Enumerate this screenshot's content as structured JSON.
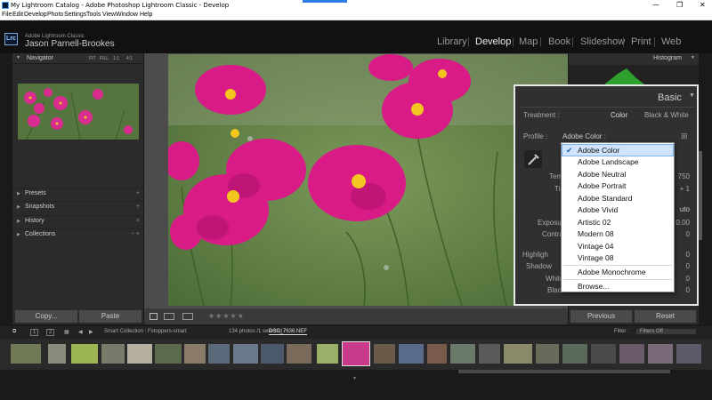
{
  "window": {
    "title": "My Lightroom Catalog - Adobe Photoshop Lightroom Classic - Develop",
    "controls": [
      "—",
      "❐",
      "✕"
    ]
  },
  "menubar": [
    "File",
    "Edit",
    "Develop",
    "Photo",
    "Settings",
    "Tools",
    "View",
    "Window",
    "Help"
  ],
  "identity": {
    "logo": "Lrc",
    "app": "Adobe Lightroom Classic",
    "user": "Jason Parnell-Brookes"
  },
  "modules": [
    "Library",
    "Develop",
    "Map",
    "Book",
    "Slideshow",
    "Print",
    "Web"
  ],
  "active_module": "Develop",
  "left_panel": {
    "navigator": {
      "title": "Navigator",
      "zoom_options": [
        "FIT",
        "FILL",
        "1:1",
        "4:1"
      ]
    },
    "sections": [
      {
        "label": "Presets",
        "action": "+"
      },
      {
        "label": "Snapshots",
        "action": "+"
      },
      {
        "label": "History",
        "action": "×"
      },
      {
        "label": "Collections",
        "action": "− +"
      }
    ],
    "copy_button": "Copy...",
    "paste_button": "Paste"
  },
  "right_panel": {
    "histogram_title": "Histogram",
    "basic": {
      "title": "Basic",
      "treatment_label": "Treatment :",
      "treatment_options": [
        "Color",
        "Black & White"
      ],
      "profile_label": "Profile :",
      "profile_value": "Adobe Color :",
      "partial_labels": {
        "temp": "Temp",
        "tint": "Tin",
        "exposure": "Exposur",
        "contrast": "Contra",
        "highlights": "Highligh",
        "shadows": "Shadow",
        "whites": "White",
        "blacks": "Black"
      },
      "partial_values": {
        "temp": "750",
        "tint": "+ 1",
        "auto": "uto",
        "exposure": "0.00",
        "contrast": "0",
        "highlights": "0",
        "shadows": "0",
        "whites": "0",
        "blacks": "0"
      }
    },
    "profile_dropdown": {
      "selected": "Adobe Color",
      "items": [
        "Adobe Color",
        "Adobe Landscape",
        "Adobe Neutral",
        "Adobe Portrait",
        "Adobe Standard",
        "Adobe Vivid",
        "Artistic 02",
        "Modern 08",
        "Vintage 04",
        "Vintage 08"
      ],
      "extra": "Adobe Monochrome",
      "browse": "Browse..."
    },
    "previous_button": "Previous",
    "reset_button": "Reset"
  },
  "filmstrip": {
    "pages": [
      "1",
      "2"
    ],
    "source": "Smart Collection : Fstoppers-smart",
    "count": "134 photos /1 selected /",
    "filename": "DSC_7636.NEF",
    "filter_label": "Filter :",
    "filter_value": "Filters Off"
  },
  "colors": {
    "accent": "#e8e8e8",
    "panel": "#2b2b2b",
    "highlight": "#cfe4fa"
  }
}
